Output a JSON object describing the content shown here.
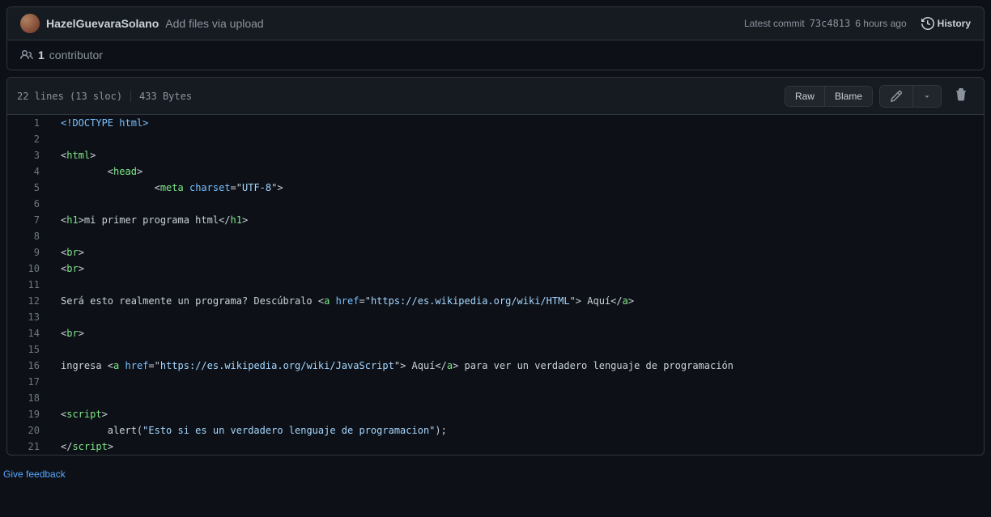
{
  "commit_bar": {
    "author": "HazelGuevaraSolano",
    "message": "Add files via upload",
    "latest_label": "Latest commit",
    "sha": "73c4813",
    "time": "6 hours ago",
    "history": "History"
  },
  "contrib": {
    "count": "1",
    "label": "contributor"
  },
  "file_header": {
    "stats_left": "22 lines (13 sloc)",
    "stats_right": "433 Bytes",
    "raw": "Raw",
    "blame": "Blame"
  },
  "code": {
    "lines": [
      [
        {
          "t": "<!",
          "c": "pl-dt"
        },
        {
          "t": "DOCTYPE ",
          "c": "pl-dt"
        },
        {
          "t": "html",
          "c": "pl-dt"
        },
        {
          "t": ">",
          "c": "pl-dt"
        }
      ],
      [],
      [
        {
          "t": "<",
          "c": ""
        },
        {
          "t": "html",
          "c": "pl-ent"
        },
        {
          "t": ">",
          "c": ""
        }
      ],
      [
        {
          "t": "        <",
          "c": ""
        },
        {
          "t": "head",
          "c": "pl-ent"
        },
        {
          "t": ">",
          "c": ""
        }
      ],
      [
        {
          "t": "                <",
          "c": ""
        },
        {
          "t": "meta",
          "c": "pl-ent"
        },
        {
          "t": " ",
          "c": ""
        },
        {
          "t": "charset",
          "c": "pl-e"
        },
        {
          "t": "=\"",
          "c": ""
        },
        {
          "t": "UTF-8",
          "c": "pl-s"
        },
        {
          "t": "\">",
          "c": ""
        }
      ],
      [],
      [
        {
          "t": "<",
          "c": ""
        },
        {
          "t": "h1",
          "c": "pl-ent"
        },
        {
          "t": ">mi primer programa html</",
          "c": ""
        },
        {
          "t": "h1",
          "c": "pl-ent"
        },
        {
          "t": ">",
          "c": ""
        }
      ],
      [],
      [
        {
          "t": "<",
          "c": ""
        },
        {
          "t": "br",
          "c": "pl-ent"
        },
        {
          "t": ">",
          "c": ""
        }
      ],
      [
        {
          "t": "<",
          "c": ""
        },
        {
          "t": "br",
          "c": "pl-ent"
        },
        {
          "t": ">",
          "c": ""
        }
      ],
      [],
      [
        {
          "t": "Será esto realmente un programa? Descúbralo <",
          "c": ""
        },
        {
          "t": "a",
          "c": "pl-ent"
        },
        {
          "t": " ",
          "c": ""
        },
        {
          "t": "href",
          "c": "pl-e"
        },
        {
          "t": "=\"",
          "c": ""
        },
        {
          "t": "https://es.wikipedia.org/wiki/HTML",
          "c": "pl-s"
        },
        {
          "t": "\"> Aquí</",
          "c": ""
        },
        {
          "t": "a",
          "c": "pl-ent"
        },
        {
          "t": ">",
          "c": ""
        }
      ],
      [],
      [
        {
          "t": "<",
          "c": ""
        },
        {
          "t": "br",
          "c": "pl-ent"
        },
        {
          "t": ">",
          "c": ""
        }
      ],
      [],
      [
        {
          "t": "ingresa <",
          "c": ""
        },
        {
          "t": "a",
          "c": "pl-ent"
        },
        {
          "t": " ",
          "c": ""
        },
        {
          "t": "href",
          "c": "pl-e"
        },
        {
          "t": "=\"",
          "c": ""
        },
        {
          "t": "https://es.wikipedia.org/wiki/JavaScript",
          "c": "pl-s"
        },
        {
          "t": "\"> Aquí</",
          "c": ""
        },
        {
          "t": "a",
          "c": "pl-ent"
        },
        {
          "t": "> para ver un verdadero lenguaje de programación",
          "c": ""
        }
      ],
      [],
      [],
      [
        {
          "t": "<",
          "c": ""
        },
        {
          "t": "script",
          "c": "pl-ent"
        },
        {
          "t": ">",
          "c": ""
        }
      ],
      [
        {
          "t": "        alert(",
          "c": ""
        },
        {
          "t": "\"Esto si es un verdadero lenguaje de programacion\"",
          "c": "pl-s"
        },
        {
          "t": ");",
          "c": ""
        }
      ],
      [
        {
          "t": "</",
          "c": ""
        },
        {
          "t": "script",
          "c": "pl-ent"
        },
        {
          "t": ">",
          "c": ""
        }
      ]
    ]
  },
  "feedback": "Give feedback"
}
